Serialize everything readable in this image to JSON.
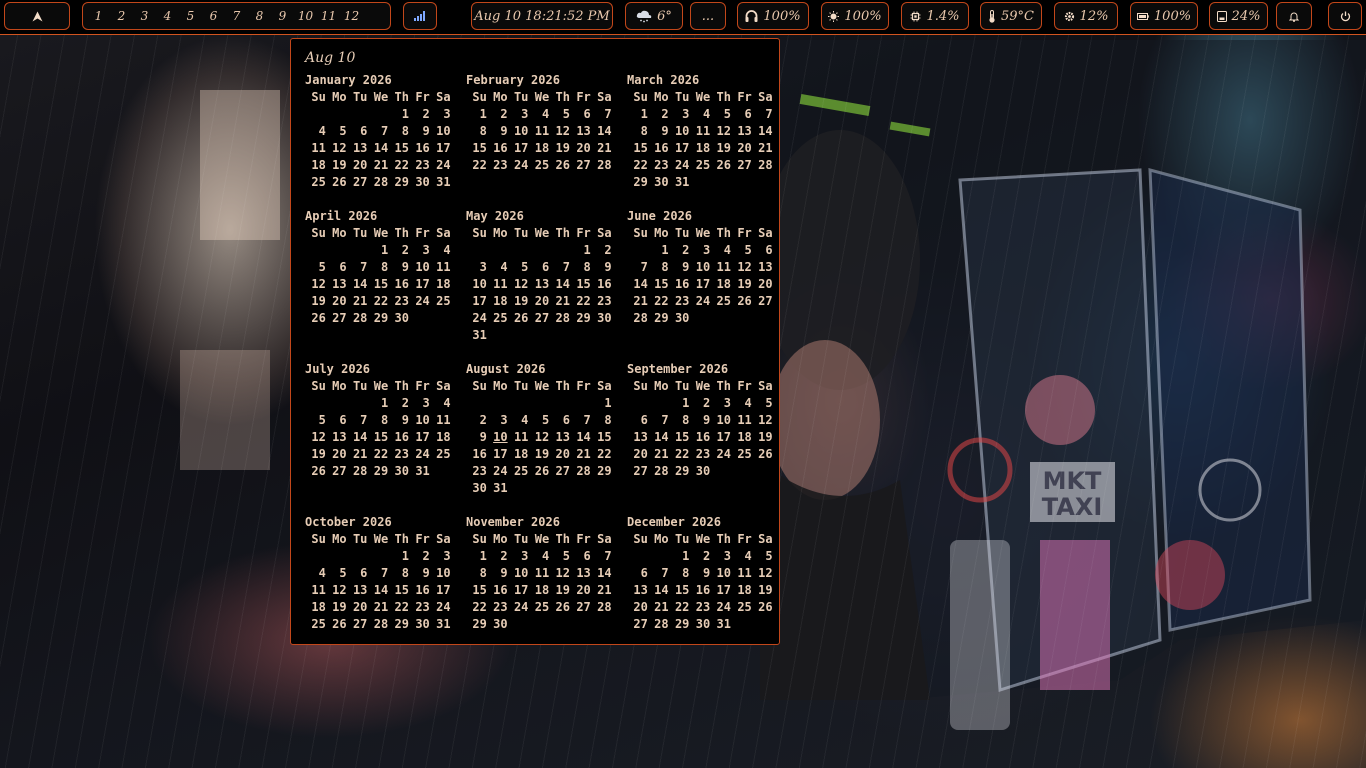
{
  "topbar": {
    "launcher": {
      "icon": "arch-logo-icon"
    },
    "workspaces": [
      "1",
      "2",
      "3",
      "4",
      "5",
      "6",
      "7",
      "8",
      "9",
      "10",
      "11",
      "12"
    ],
    "network": {
      "icon": "signal-bars-icon"
    },
    "clock": {
      "text": "Aug 10 18:21:52 PM"
    },
    "weather": {
      "icon": "cloud-snow-icon",
      "text": "6°"
    },
    "more": {
      "text": "..."
    },
    "headphones": {
      "icon": "headphones-icon",
      "text": "100%"
    },
    "brightness": {
      "icon": "sun-icon",
      "text": "100%"
    },
    "cpu": {
      "icon": "cpu-icon",
      "text": "1.4%"
    },
    "temperature": {
      "icon": "thermometer-icon",
      "text": "59°C"
    },
    "memory": {
      "icon": "cog-memory-icon",
      "text": "12%"
    },
    "battery": {
      "icon": "battery-icon",
      "text": "100%"
    },
    "disk": {
      "icon": "disk-icon",
      "text": "24%"
    },
    "notifications": {
      "icon": "bell-icon"
    },
    "power": {
      "icon": "power-icon"
    }
  },
  "calendar": {
    "title": "Aug 10",
    "weekdays": [
      "Su",
      "Mo",
      "Tu",
      "We",
      "Th",
      "Fr",
      "Sa"
    ],
    "today": {
      "month": 7,
      "day": 10
    },
    "months": [
      {
        "name": "January 2026",
        "offset": 4,
        "days": 31
      },
      {
        "name": "February 2026",
        "offset": 0,
        "days": 28
      },
      {
        "name": "March 2026",
        "offset": 0,
        "days": 31
      },
      {
        "name": "April 2026",
        "offset": 3,
        "days": 30
      },
      {
        "name": "May 2026",
        "offset": 5,
        "days": 31
      },
      {
        "name": "June 2026",
        "offset": 1,
        "days": 30
      },
      {
        "name": "July 2026",
        "offset": 3,
        "days": 31
      },
      {
        "name": "August 2026",
        "offset": 6,
        "days": 31
      },
      {
        "name": "September 2026",
        "offset": 2,
        "days": 30
      },
      {
        "name": "October 2026",
        "offset": 4,
        "days": 31
      },
      {
        "name": "November 2026",
        "offset": 0,
        "days": 30
      },
      {
        "name": "December 2026",
        "offset": 2,
        "days": 31
      }
    ]
  },
  "wallpaper": {
    "signage": "MKT TAXI"
  },
  "colors": {
    "accent": "#c2471a",
    "text": "#e7cdb6",
    "bar_bg": "#000000"
  }
}
